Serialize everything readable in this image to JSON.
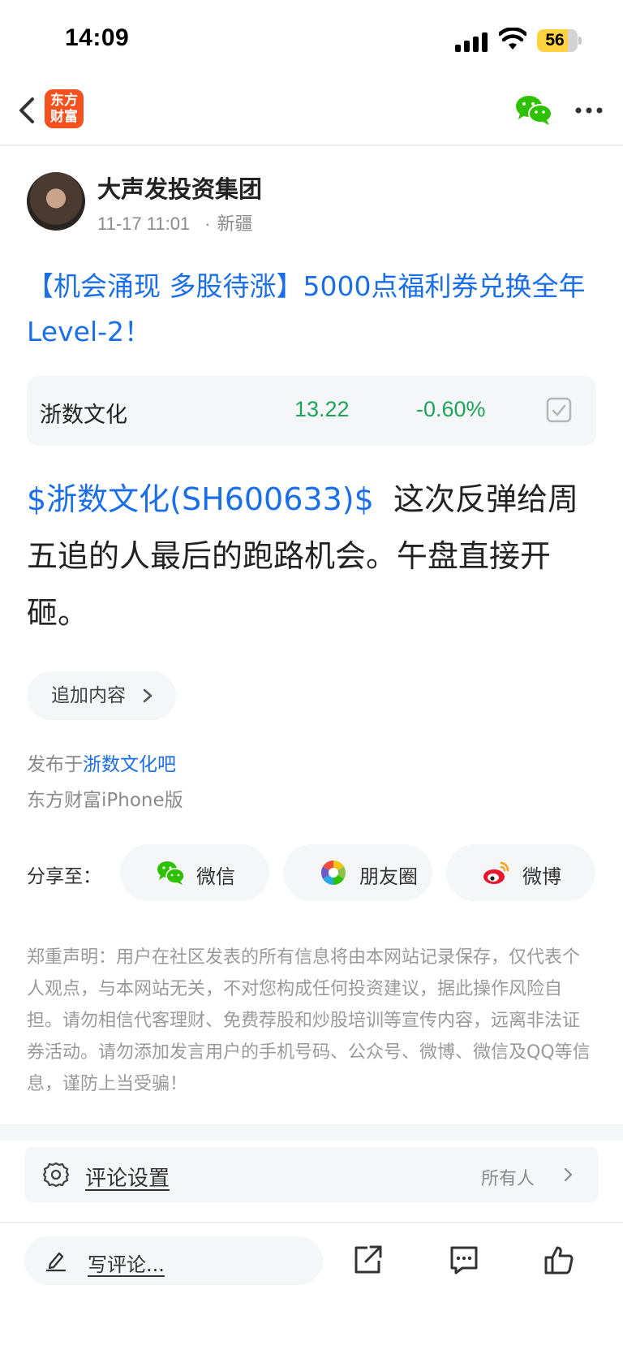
{
  "status_bar": {
    "time": "14:09",
    "battery": "56"
  },
  "nav": {
    "logo_text_line1": "东方",
    "logo_text_line2": "财富"
  },
  "author": {
    "name": "大声发投资集团",
    "datetime": "11-17 11:01",
    "dot": "·",
    "location": "新疆"
  },
  "post": {
    "title": "【机会涌现 多股待涨】5000点福利券兑换全年Level-2！",
    "stock_card": {
      "name": "浙数文化",
      "price": "13.22",
      "change": "-0.60%"
    },
    "body_link": "$浙数文化(SH600633)$",
    "body_text": "这次反弹给周五追的人最后的跑路机会。午盘直接开砸。",
    "append_label": "追加内容",
    "published_prefix": "发布于",
    "published_bar": "浙数文化吧",
    "client": "东方财富iPhone版"
  },
  "share": {
    "label": "分享至：",
    "items": [
      {
        "label": "微信",
        "icon": "wechat-icon"
      },
      {
        "label": "朋友圈",
        "icon": "moments-icon"
      },
      {
        "label": "微博",
        "icon": "weibo-icon"
      }
    ]
  },
  "disclaimer": "郑重声明：用户在社区发表的所有信息将由本网站记录保存，仅代表个人观点，与本网站无关，不对您构成任何投资建议，据此操作风险自担。请勿相信代客理财、免费荐股和炒股培训等宣传内容，远离非法证券活动。请勿添加发言用户的手机号码、公众号、微博、微信及QQ等信息，谨防上当受骗！",
  "comment_settings": {
    "label": "评论设置",
    "value": "所有人"
  },
  "bottom_bar": {
    "placeholder": "写评论..."
  },
  "colors": {
    "link_blue": "#1a6fe8",
    "down_green": "#1ea35b",
    "brand_orange": "#f4511e"
  }
}
